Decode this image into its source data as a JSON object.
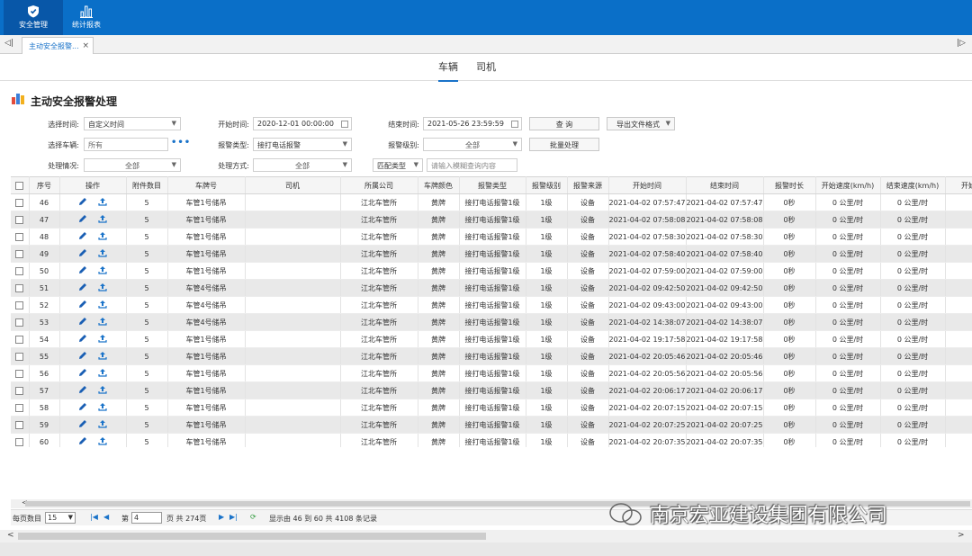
{
  "topnav": [
    {
      "label": "安全管理",
      "icon": "shield-icon"
    },
    {
      "label": "统计报表",
      "icon": "bar-chart-icon"
    }
  ],
  "tabs": [
    {
      "label": "主动安全报警...",
      "close": "×"
    }
  ],
  "tab_scroll": {
    "left": "◁|",
    "right": "|▷"
  },
  "subtabs": [
    {
      "label": "车辆",
      "active": true
    },
    {
      "label": "司机",
      "active": false
    }
  ],
  "page_title": "主动安全报警处理",
  "filters": {
    "time_select_label": "选择时间:",
    "time_select_value": "自定义时间",
    "start_label": "开始时间:",
    "start_value": "2020-12-01 00:00:00",
    "end_label": "结束时间:",
    "end_value": "2021-05-26 23:59:59",
    "query_button": "查 询",
    "export_button": "导出文件格式",
    "vehicle_label": "选择车辆:",
    "vehicle_value": "所有",
    "vehicle_more": "•••",
    "alarm_type_label": "报警类型:",
    "alarm_type_value": "接打电话报警",
    "alarm_level_label": "报警级别:",
    "alarm_level_value": "全部",
    "batch_button": "批量处理",
    "status_label": "处理情况:",
    "status_value": "全部",
    "method_label": "处理方式:",
    "method_value": "全部",
    "match_value": "匹配类型",
    "fuzzy_placeholder": "请输入模糊查询内容"
  },
  "table": {
    "columns": [
      "序号",
      "操作",
      "附件数目",
      "车牌号",
      "司机",
      "所属公司",
      "车牌颜色",
      "报警类型",
      "报警级别",
      "报警来源",
      "开始时间",
      "结束时间",
      "报警时长",
      "开始速度(km/h)",
      "结束速度(km/h)",
      "开始"
    ],
    "rows": [
      [
        "46",
        "5",
        "车管1号储吊",
        "",
        "江北车管所",
        "黄牌",
        "接打电话报警1级",
        "1级",
        "设备",
        "2021-04-02 07:57:47",
        "2021-04-02 07:57:47",
        "0秒",
        "0 公里/时",
        "0 公里/时"
      ],
      [
        "47",
        "5",
        "车管1号储吊",
        "",
        "江北车管所",
        "黄牌",
        "接打电话报警1级",
        "1级",
        "设备",
        "2021-04-02 07:58:08",
        "2021-04-02 07:58:08",
        "0秒",
        "0 公里/时",
        "0 公里/时"
      ],
      [
        "48",
        "5",
        "车管1号储吊",
        "",
        "江北车管所",
        "黄牌",
        "接打电话报警1级",
        "1级",
        "设备",
        "2021-04-02 07:58:30",
        "2021-04-02 07:58:30",
        "0秒",
        "0 公里/时",
        "0 公里/时"
      ],
      [
        "49",
        "5",
        "车管1号储吊",
        "",
        "江北车管所",
        "黄牌",
        "接打电话报警1级",
        "1级",
        "设备",
        "2021-04-02 07:58:40",
        "2021-04-02 07:58:40",
        "0秒",
        "0 公里/时",
        "0 公里/时"
      ],
      [
        "50",
        "5",
        "车管1号储吊",
        "",
        "江北车管所",
        "黄牌",
        "接打电话报警1级",
        "1级",
        "设备",
        "2021-04-02 07:59:00",
        "2021-04-02 07:59:00",
        "0秒",
        "0 公里/时",
        "0 公里/时"
      ],
      [
        "51",
        "5",
        "车管4号储吊",
        "",
        "江北车管所",
        "黄牌",
        "接打电话报警1级",
        "1级",
        "设备",
        "2021-04-02 09:42:50",
        "2021-04-02 09:42:50",
        "0秒",
        "0 公里/时",
        "0 公里/时"
      ],
      [
        "52",
        "5",
        "车管4号储吊",
        "",
        "江北车管所",
        "黄牌",
        "接打电话报警1级",
        "1级",
        "设备",
        "2021-04-02 09:43:00",
        "2021-04-02 09:43:00",
        "0秒",
        "0 公里/时",
        "0 公里/时"
      ],
      [
        "53",
        "5",
        "车管4号储吊",
        "",
        "江北车管所",
        "黄牌",
        "接打电话报警1级",
        "1级",
        "设备",
        "2021-04-02 14:38:07",
        "2021-04-02 14:38:07",
        "0秒",
        "0 公里/时",
        "0 公里/时"
      ],
      [
        "54",
        "5",
        "车管1号储吊",
        "",
        "江北车管所",
        "黄牌",
        "接打电话报警1级",
        "1级",
        "设备",
        "2021-04-02 19:17:58",
        "2021-04-02 19:17:58",
        "0秒",
        "0 公里/时",
        "0 公里/时"
      ],
      [
        "55",
        "5",
        "车管1号储吊",
        "",
        "江北车管所",
        "黄牌",
        "接打电话报警1级",
        "1级",
        "设备",
        "2021-04-02 20:05:46",
        "2021-04-02 20:05:46",
        "0秒",
        "0 公里/时",
        "0 公里/时"
      ],
      [
        "56",
        "5",
        "车管1号储吊",
        "",
        "江北车管所",
        "黄牌",
        "接打电话报警1级",
        "1级",
        "设备",
        "2021-04-02 20:05:56",
        "2021-04-02 20:05:56",
        "0秒",
        "0 公里/时",
        "0 公里/时"
      ],
      [
        "57",
        "5",
        "车管1号储吊",
        "",
        "江北车管所",
        "黄牌",
        "接打电话报警1级",
        "1级",
        "设备",
        "2021-04-02 20:06:17",
        "2021-04-02 20:06:17",
        "0秒",
        "0 公里/时",
        "0 公里/时"
      ],
      [
        "58",
        "5",
        "车管1号储吊",
        "",
        "江北车管所",
        "黄牌",
        "接打电话报警1级",
        "1级",
        "设备",
        "2021-04-02 20:07:15",
        "2021-04-02 20:07:15",
        "0秒",
        "0 公里/时",
        "0 公里/时"
      ],
      [
        "59",
        "5",
        "车管1号储吊",
        "",
        "江北车管所",
        "黄牌",
        "接打电话报警1级",
        "1级",
        "设备",
        "2021-04-02 20:07:25",
        "2021-04-02 20:07:25",
        "0秒",
        "0 公里/时",
        "0 公里/时"
      ],
      [
        "60",
        "5",
        "车管1号储吊",
        "",
        "江北车管所",
        "黄牌",
        "接打电话报警1级",
        "1级",
        "设备",
        "2021-04-02 20:07:35",
        "2021-04-02 20:07:35",
        "0秒",
        "0 公里/时",
        "0 公里/时"
      ]
    ]
  },
  "pager": {
    "per_page_label": "每页数目",
    "per_page_value": "15",
    "page_prefix": "第",
    "page_value": "4",
    "page_suffix": "页  共 274页",
    "summary": "显示由 46 到 60 共 4108 条记录"
  },
  "watermark": "南京宏亚建设集团有限公司",
  "colors": {
    "brand": "#0a6fc8",
    "accent": "#1a73c9",
    "row_alt": "#e9e9e9"
  }
}
